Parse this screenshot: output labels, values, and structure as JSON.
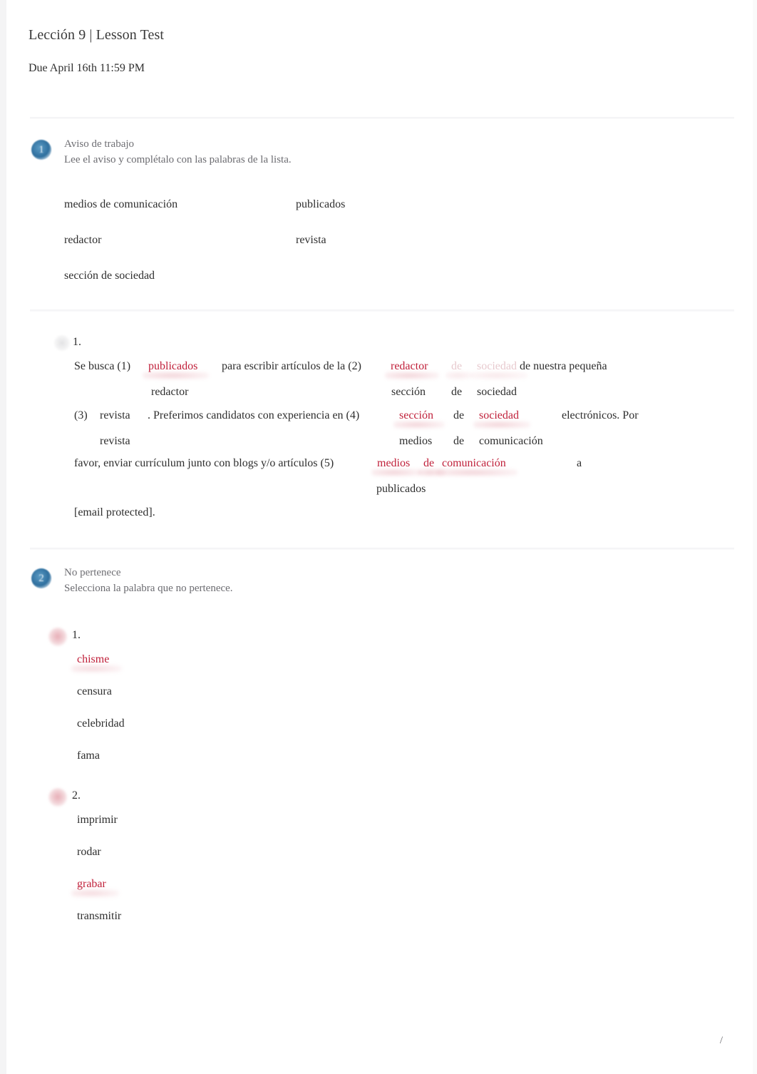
{
  "document": {
    "title": "Lección 9 | Lesson Test",
    "due": "Due April 16th 11:59 PM",
    "footer_mark": "/"
  },
  "colors": {
    "badge_blue": "#3a7ca8",
    "wrong_red": "#c0203a",
    "body_text": "#2e2e2e",
    "muted_text": "#6f6f74"
  },
  "activities": [
    {
      "number": "1",
      "title": "Aviso de trabajo",
      "instructions": "Lee el aviso y complétalo con las palabras de la lista.",
      "word_bank": [
        [
          "medios de comunicación",
          "publicados"
        ],
        [
          "redactor",
          "revista"
        ],
        [
          "sección de sociedad",
          ""
        ]
      ],
      "question": {
        "number": "1.",
        "text_fragments": {
          "f1": "Se busca (1)",
          "f2": "para escribir artículos de la (2)",
          "f3": "de nuestra pequeña",
          "f4": "(3)",
          "f5": ". Preferimos candidatos con experiencia en (4)",
          "f6": "electrónicos. Por",
          "f7": "favor, enviar currículum junto con blogs y/o artículos (5)",
          "f8": "a",
          "f9": "[email protected]."
        },
        "blanks": [
          {
            "id": "1",
            "student_answer": "publicados",
            "student_correct": false,
            "correct_answer": "redactor"
          },
          {
            "id": "2",
            "student_answer_parts": [
              "redactor",
              "de",
              "sociedad"
            ],
            "student_correct": false,
            "correct_answer_parts": [
              "sección",
              "de",
              "sociedad"
            ]
          },
          {
            "id": "3",
            "student_answer": "revista",
            "student_correct": true,
            "correct_answer": "revista"
          },
          {
            "id": "4",
            "student_answer_parts": [
              "sección",
              "de",
              "sociedad"
            ],
            "student_correct": false,
            "correct_answer_parts": [
              "medios",
              "de",
              "comunicación"
            ]
          },
          {
            "id": "5",
            "student_answer_parts": [
              "medios",
              "de",
              "comunicación"
            ],
            "student_correct": false,
            "correct_answer": "publicados"
          }
        ]
      }
    },
    {
      "number": "2",
      "title": "No pertenece",
      "instructions": "Selecciona la palabra que no pertenece.",
      "questions": [
        {
          "number": "1.",
          "options": [
            "chisme",
            "censura",
            "celebridad",
            "fama"
          ],
          "selected": "chisme",
          "correct": false
        },
        {
          "number": "2.",
          "options": [
            "imprimir",
            "rodar",
            "grabar",
            "transmitir"
          ],
          "selected": "grabar",
          "correct": false
        }
      ]
    }
  ]
}
